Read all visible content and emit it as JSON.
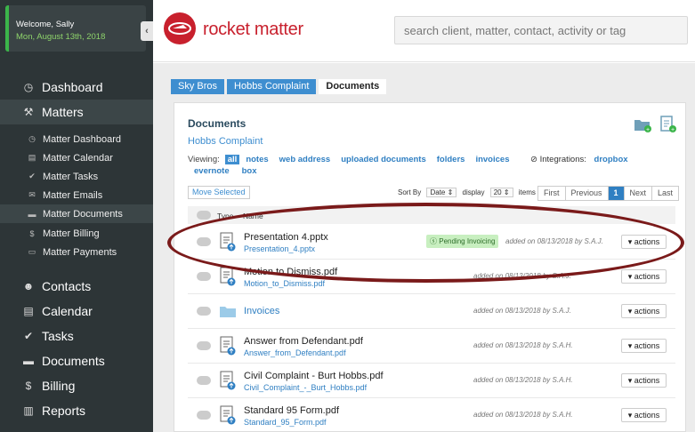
{
  "sidebar": {
    "welcome": "Welcome, Sally",
    "date": "Mon, August 13th, 2018",
    "collapse_glyph": "‹",
    "dashboard": "Dashboard",
    "matters": "Matters",
    "sub": [
      "Matter Dashboard",
      "Matter Calendar",
      "Matter Tasks",
      "Matter Emails",
      "Matter Documents",
      "Matter Billing",
      "Matter Payments"
    ],
    "contacts": "Contacts",
    "calendar": "Calendar",
    "tasks": "Tasks",
    "documents": "Documents",
    "billing": "Billing",
    "reports": "Reports"
  },
  "header": {
    "logo_text": "rocket matter",
    "search_placeholder": "search client, matter, contact, activity or tag"
  },
  "breadcrumb": [
    "Sky Bros",
    "Hobbs Complaint",
    "Documents"
  ],
  "panel": {
    "title": "Documents",
    "matter": "Hobbs Complaint",
    "viewing_label": "Viewing:",
    "filters": [
      "all",
      "notes",
      "web address",
      "uploaded documents",
      "folders",
      "invoices"
    ],
    "integrations_label": "Integrations:",
    "integrations": [
      "dropbox",
      "evernote",
      "box"
    ],
    "move_selected": "Move Selected",
    "sort_by": "Sort By",
    "sort_value": "Date",
    "display": "display",
    "display_value": "20",
    "items": "items",
    "pager": [
      "First",
      "Previous",
      "1",
      "Next",
      "Last"
    ],
    "col_type": "Type",
    "col_name": "Name",
    "actions_label": "actions"
  },
  "rows": [
    {
      "name": "Presentation 4.pptx",
      "link": "Presentation_4.pptx",
      "badge": "Pending Invoicing",
      "added": "added on 08/13/2018 by S.A.J."
    },
    {
      "name": "Motion to Dismiss.pdf",
      "link": "Motion_to_Dismiss.pdf",
      "added": "added on 08/13/2018 by S.A.J."
    },
    {
      "folder": "Invoices",
      "added": "added on 08/13/2018 by S.A.J."
    },
    {
      "name": "Answer from Defendant.pdf",
      "link": "Answer_from_Defendant.pdf",
      "added": "added on 08/13/2018 by S.A.H."
    },
    {
      "name": "Civil Complaint - Burt Hobbs.pdf",
      "link": "Civil_Complaint_-_Burt_Hobbs.pdf",
      "added": "added on 08/13/2018 by S.A.H."
    },
    {
      "name": "Standard 95 Form.pdf",
      "link": "Standard_95_Form.pdf",
      "added": "added on 08/13/2018 by S.A.H."
    }
  ],
  "colors": {
    "brand": "#c8202d",
    "accent": "#3e8ed0",
    "sidebar": "#2d3537",
    "highlight_oval": "#7a1a1a"
  }
}
